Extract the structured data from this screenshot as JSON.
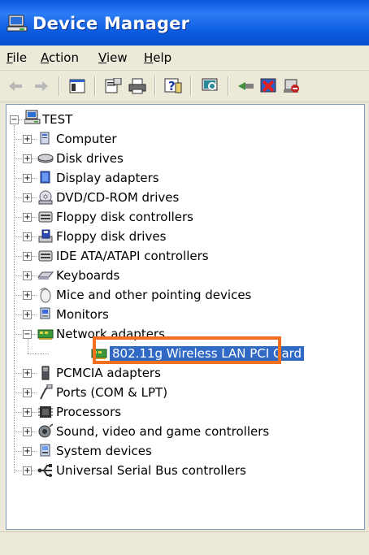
{
  "window": {
    "title": "Device Manager"
  },
  "menu": [
    {
      "label": "File",
      "ul": "F",
      "rest": "ile"
    },
    {
      "label": "Action",
      "ul": "A",
      "rest": "ction"
    },
    {
      "label": "View",
      "ul": "V",
      "rest": "iew"
    },
    {
      "label": "Help",
      "ul": "H",
      "rest": "elp"
    }
  ],
  "toolbar": {
    "buttons": [
      "back-icon",
      "forward-icon",
      "show-hide-console-tree-icon",
      "properties-icon",
      "print-icon",
      "help-icon",
      "scan-hardware-icon",
      "update-driver-icon",
      "uninstall-icon",
      "disable-icon"
    ]
  },
  "tree": {
    "root": "TEST",
    "nodes": [
      {
        "label": "Computer",
        "icon": "computer-icon"
      },
      {
        "label": "Disk drives",
        "icon": "disk-drive-icon"
      },
      {
        "label": "Display adapters",
        "icon": "display-adapter-icon"
      },
      {
        "label": "DVD/CD-ROM drives",
        "icon": "dvd-drive-icon"
      },
      {
        "label": "Floppy disk controllers",
        "icon": "floppy-controller-icon"
      },
      {
        "label": "Floppy disk drives",
        "icon": "floppy-drive-icon"
      },
      {
        "label": "IDE ATA/ATAPI controllers",
        "icon": "ide-controller-icon"
      },
      {
        "label": "Keyboards",
        "icon": "keyboard-icon"
      },
      {
        "label": "Mice and other pointing devices",
        "icon": "mouse-icon"
      },
      {
        "label": "Monitors",
        "icon": "monitor-icon"
      },
      {
        "label": "Network adapters",
        "icon": "network-adapter-icon",
        "expanded": true,
        "children": [
          {
            "label": "802.11g Wireless LAN PCI Card",
            "icon": "network-card-icon",
            "selected": true
          }
        ]
      },
      {
        "label": "PCMCIA adapters",
        "icon": "pcmcia-icon"
      },
      {
        "label": "Ports (COM & LPT)",
        "icon": "port-icon"
      },
      {
        "label": "Processors",
        "icon": "processor-icon"
      },
      {
        "label": "Sound, video and game controllers",
        "icon": "sound-icon"
      },
      {
        "label": "System devices",
        "icon": "system-device-icon"
      },
      {
        "label": "Universal Serial Bus controllers",
        "icon": "usb-icon"
      }
    ]
  },
  "colors": {
    "titlebar": "#0a58e0",
    "highlight": "#f07020",
    "selection": "#316ac5"
  }
}
